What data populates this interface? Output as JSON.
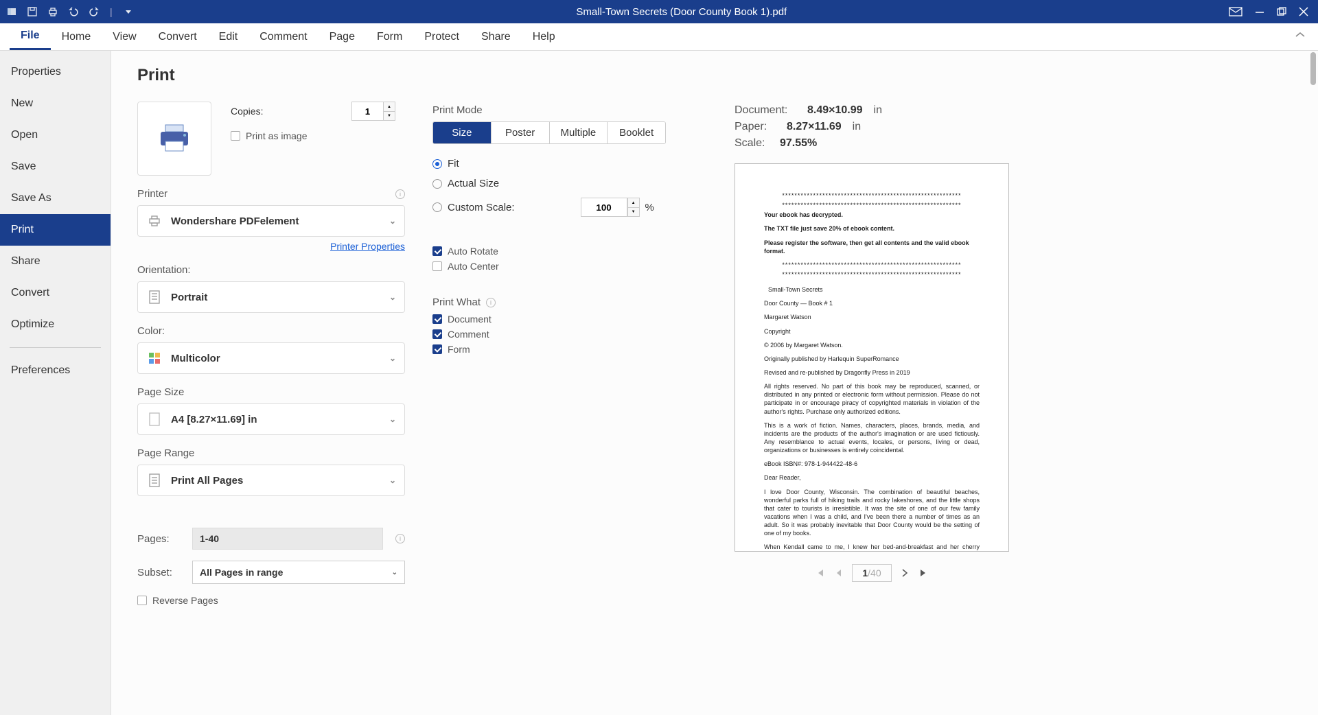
{
  "titlebar": {
    "title": "Small-Town Secrets (Door County Book 1).pdf"
  },
  "menubar": {
    "items": [
      "File",
      "Home",
      "View",
      "Convert",
      "Edit",
      "Comment",
      "Page",
      "Form",
      "Protect",
      "Share",
      "Help"
    ],
    "active": "File"
  },
  "sidebar": {
    "items": [
      "Properties",
      "New",
      "Open",
      "Save",
      "Save As",
      "Print",
      "Share",
      "Convert",
      "Optimize"
    ],
    "active": "Print",
    "preferences": "Preferences"
  },
  "print": {
    "title": "Print",
    "copies_label": "Copies:",
    "copies_value": "1",
    "print_as_image": "Print as image",
    "printer_label": "Printer",
    "printer_value": "Wondershare PDFelement",
    "printer_props": "Printer Properties",
    "orientation_label": "Orientation:",
    "orientation_value": "Portrait",
    "color_label": "Color:",
    "color_value": "Multicolor",
    "page_size_label": "Page Size",
    "page_size_value": "A4 [8.27×11.69] in",
    "page_range_label": "Page Range",
    "page_range_value": "Print All Pages",
    "pages_label": "Pages:",
    "pages_value": "1-40",
    "subset_label": "Subset:",
    "subset_value": "All Pages in range",
    "reverse_pages": "Reverse Pages"
  },
  "mode": {
    "label": "Print Mode",
    "tabs": [
      "Size",
      "Poster",
      "Multiple",
      "Booklet"
    ],
    "active": "Size",
    "fit": "Fit",
    "actual": "Actual Size",
    "custom": "Custom Scale:",
    "custom_value": "100",
    "percent": "%",
    "auto_rotate": "Auto Rotate",
    "auto_center": "Auto Center",
    "what_label": "Print What",
    "document": "Document",
    "comment": "Comment",
    "form": "Form"
  },
  "preview": {
    "doc_label": "Document:",
    "doc_val": "8.49×10.99",
    "doc_unit": "in",
    "paper_label": "Paper:",
    "paper_val": "8.27×11.69",
    "paper_unit": "in",
    "scale_label": "Scale:",
    "scale_val": "97.55%",
    "page_current": "1",
    "page_sep": "/",
    "page_total": "40",
    "text": {
      "l1": "Your ebook has decrypted.",
      "l2": "The TXT file just save 20% of ebook content.",
      "l3": "Please register the software, then get all contents and the valid ebook format.",
      "l4": "Small-Town Secrets",
      "l5": "Door County — Book # 1",
      "l6": "Margaret Watson",
      "l7": "Copyright",
      "l8": "© 2006 by Margaret Watson.",
      "l9": "Originally published by Harlequin SuperRomance",
      "l10": "Revised and re-published by Dragonfly Press in 2019",
      "l11": "All rights reserved. No part of this book may be reproduced, scanned, or distributed in any printed or electronic form without permission. Please do not participate in or encourage piracy of copyrighted materials in violation of the author's rights. Purchase only authorized editions.",
      "l12": "This is a work of fiction. Names, characters, places, brands, media, and incidents are the products of the author's imagination or are used fictiously. Any resemblance to actual events, locales, or persons, living or dead, organizations or businesses is entirely coincidental.",
      "l13": "eBook ISBN#: 978-1-944422-48-6",
      "l14": "Dear Reader,",
      "l15": "I love Door County, Wisconsin. The combination of beautiful beaches, wonderful parks full of hiking trails and rocky lakeshores, and the little shops that cater to tourists is irresistible. It was the site of one of our few family vacations when I was a child, and I've been there a number of times as an adult. So it was probably inevitable that Door County would be the setting of one of my books.",
      "l16": "When Kendall came to me, I knew her bed-and-breakfast and her cherry orchard were in Door County. But her story resonated beyond its location. It's a story of redemption, of righting old"
    }
  }
}
